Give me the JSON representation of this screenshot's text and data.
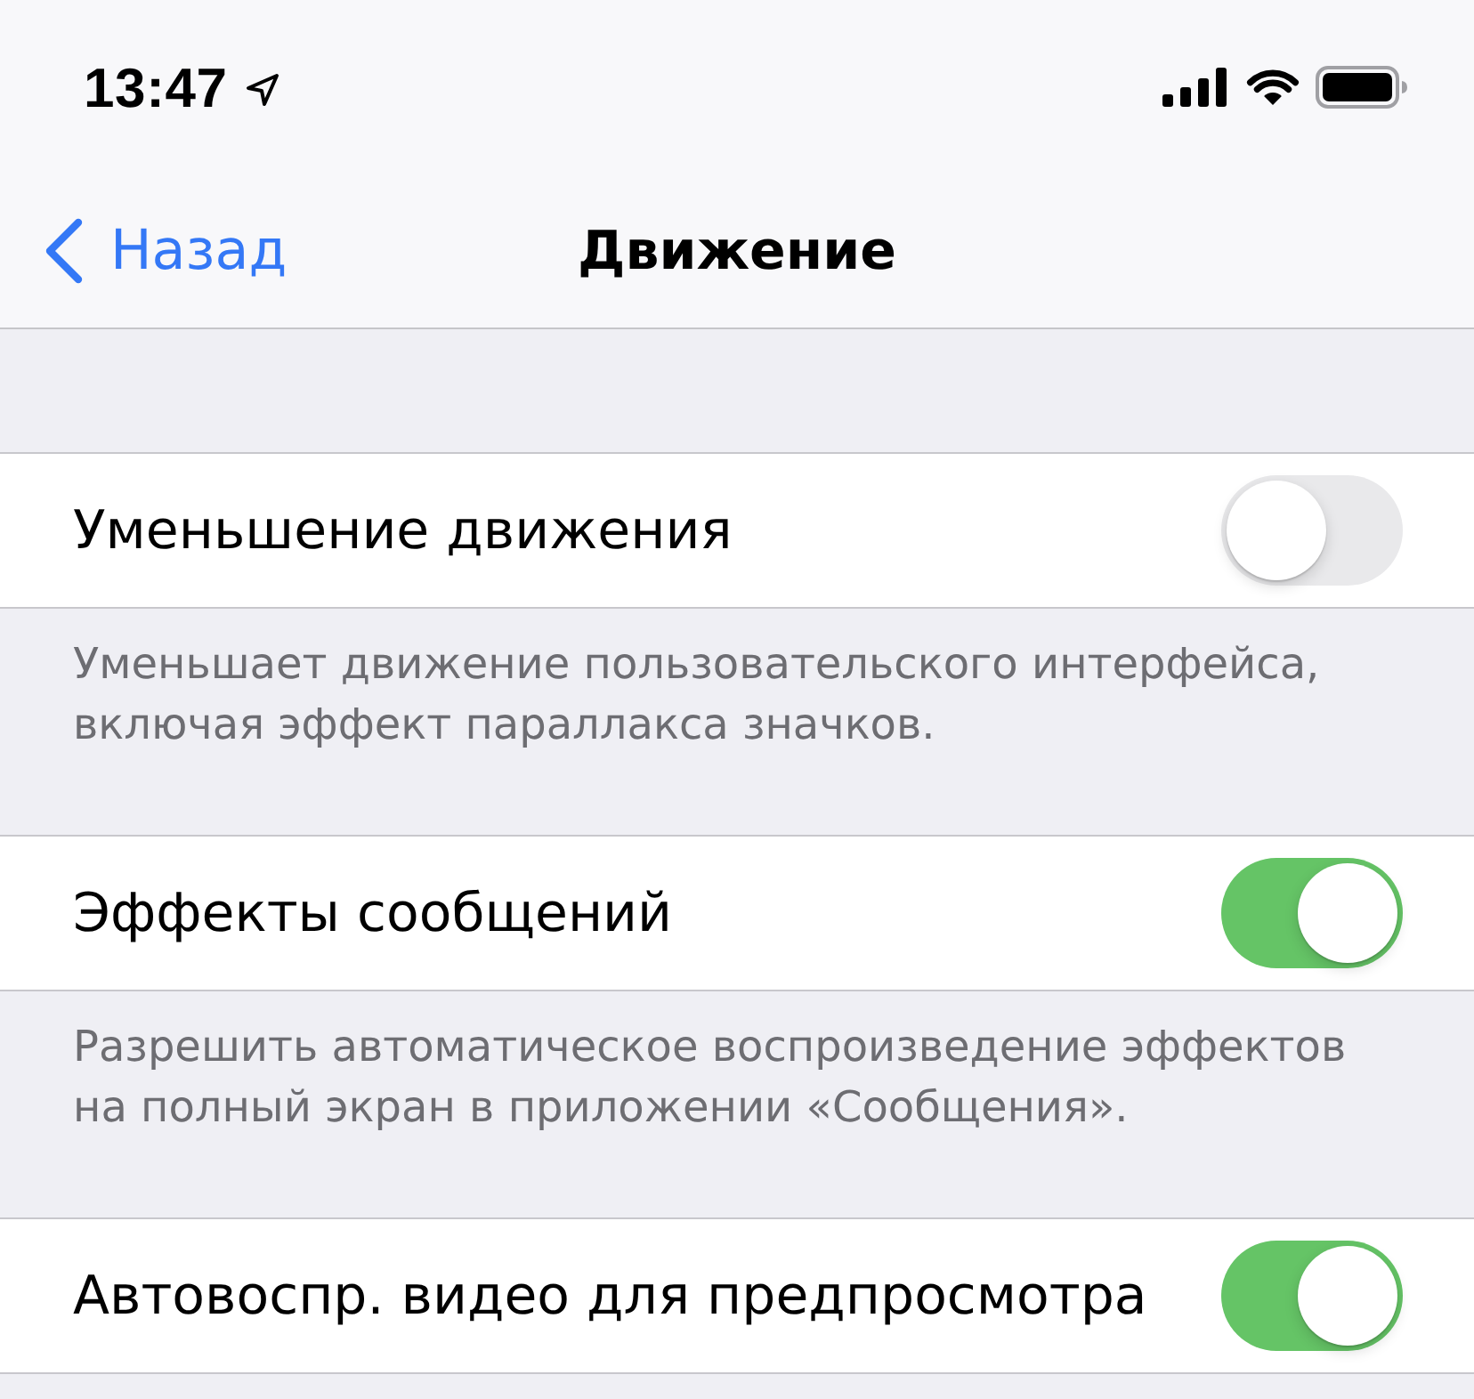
{
  "status_bar": {
    "time": "13:47"
  },
  "nav_bar": {
    "back_label": "Назад",
    "title": "Движение"
  },
  "groups": [
    {
      "label": "Уменьшение движения",
      "on": false,
      "footer": "Уменьшает движение пользовательского интерфейса, включая эффект параллакса значков."
    },
    {
      "label": "Эффекты сообщений",
      "on": true,
      "footer": "Разрешить автоматическое воспроизведение эффектов на полный экран в приложении «Сообщения»."
    },
    {
      "label": "Автовоспр. видео для предпросмотра",
      "on": true
    }
  ]
}
